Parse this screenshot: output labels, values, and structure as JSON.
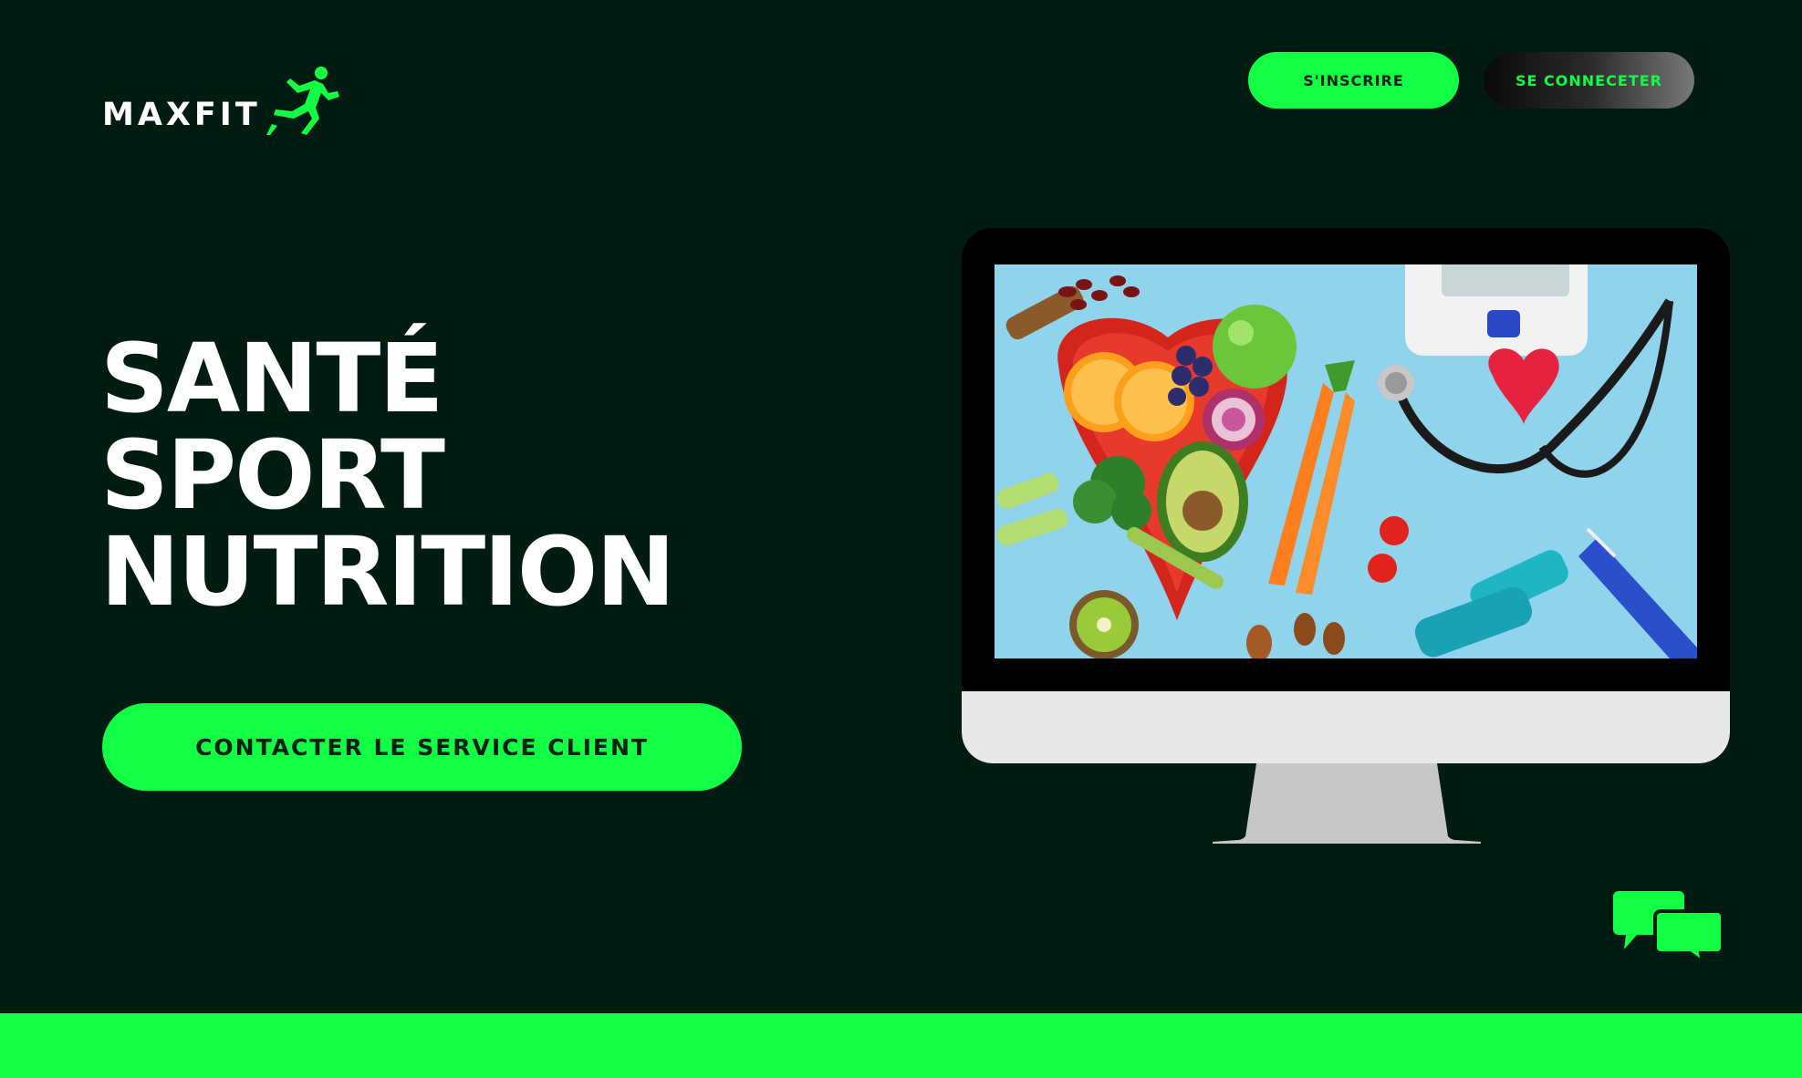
{
  "brand": {
    "name": "MAXFIT",
    "accent_color": "#12ff45",
    "background_color": "#021c12"
  },
  "header": {
    "signup_label": "S'INSCRIRE",
    "login_label": "SE CONNECETER"
  },
  "hero": {
    "lines": [
      "SANTÉ",
      "SPORT",
      "NUTRITION"
    ]
  },
  "cta": {
    "label": "CONTACTER LE SERVICE CLIENT"
  },
  "icons": {
    "logo_mark": "runner-icon",
    "chat": "chat-bubbles-icon"
  }
}
